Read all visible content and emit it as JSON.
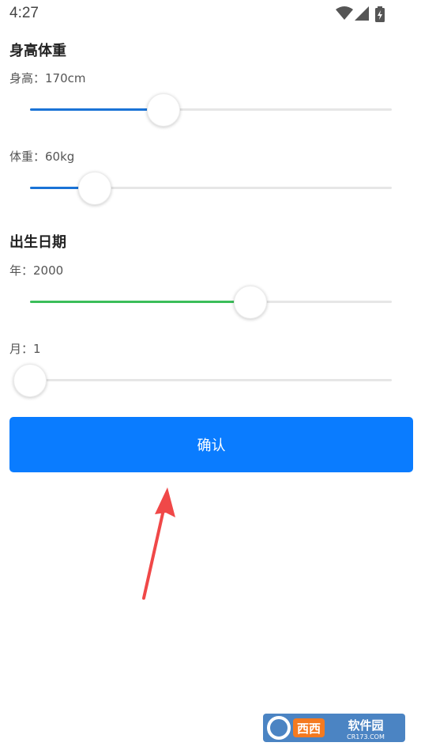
{
  "status_bar": {
    "time": "4:27",
    "icons": [
      "wifi-icon",
      "signal-icon",
      "battery-icon"
    ]
  },
  "height_weight": {
    "title": "身高体重",
    "height": {
      "label": "身高：170cm",
      "value_fraction": 0.37,
      "color": "#1a73d6"
    },
    "weight": {
      "label": "体重：60kg",
      "value_fraction": 0.18,
      "color": "#1a73d6"
    }
  },
  "birth_date": {
    "title": "出生日期",
    "year": {
      "label": "年：2000",
      "value_fraction": 0.61,
      "color": "#3cbe5a"
    },
    "month": {
      "label": "月：1",
      "value_fraction": 0.0,
      "color": "#1a73d6"
    }
  },
  "confirm_button": {
    "label": "确认",
    "color": "#0a7cff"
  },
  "annotation": {
    "icon": "red-arrow-icon",
    "color": "#f04848"
  },
  "watermark": {
    "icon": "cr173-logo-icon",
    "text": "西西软件园 CR173.COM"
  }
}
